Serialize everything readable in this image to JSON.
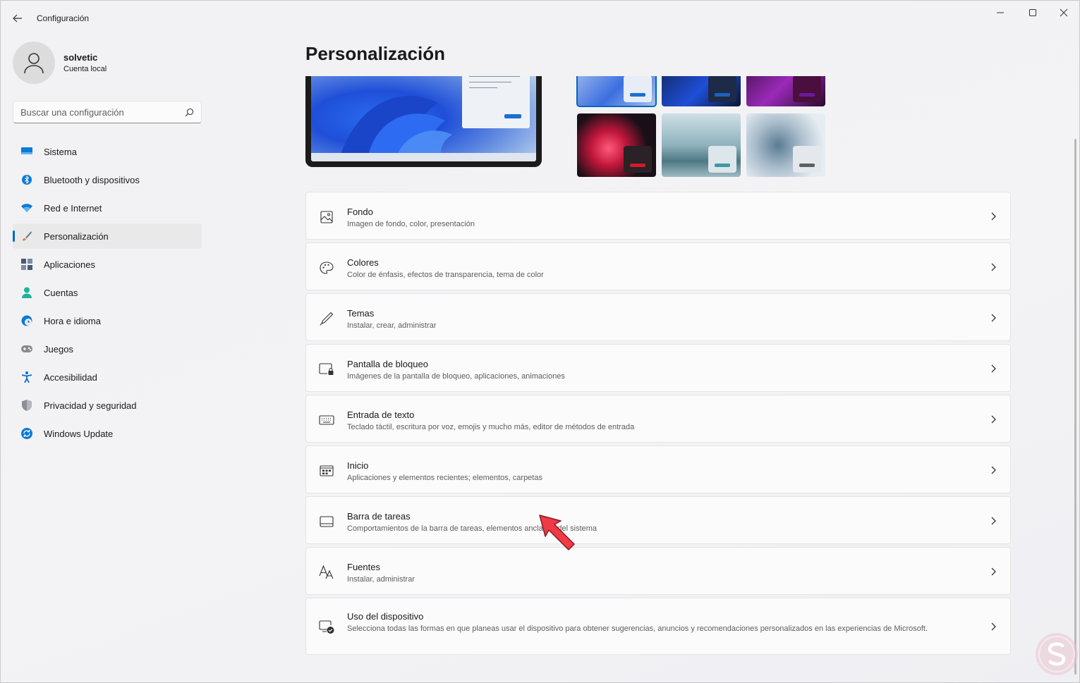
{
  "window": {
    "title": "Configuración",
    "controls": [
      "minimize",
      "maximize",
      "close"
    ]
  },
  "profile": {
    "name": "solvetic",
    "account_type": "Cuenta local"
  },
  "search": {
    "placeholder": "Buscar una configuración"
  },
  "nav": {
    "items": [
      {
        "label": "Sistema",
        "icon": "monitor-icon",
        "color": "#0a7bd6"
      },
      {
        "label": "Bluetooth y dispositivos",
        "icon": "bluetooth-icon",
        "color": "#0a7bd6"
      },
      {
        "label": "Red e Internet",
        "icon": "wifi-icon",
        "color": "#0a7bd6"
      },
      {
        "label": "Personalización",
        "icon": "brush-icon",
        "color": "#e8743b",
        "active": true
      },
      {
        "label": "Aplicaciones",
        "icon": "apps-icon",
        "color": "#4a5a74"
      },
      {
        "label": "Cuentas",
        "icon": "person-icon",
        "color": "#1db39a"
      },
      {
        "label": "Hora e idioma",
        "icon": "clock-globe-icon",
        "color": "#0a7bd6"
      },
      {
        "label": "Juegos",
        "icon": "gamepad-icon",
        "color": "#7a7a7a"
      },
      {
        "label": "Accesibilidad",
        "icon": "accessibility-icon",
        "color": "#0a6cc9"
      },
      {
        "label": "Privacidad y seguridad",
        "icon": "shield-icon",
        "color": "#7a7a7a"
      },
      {
        "label": "Windows Update",
        "icon": "update-icon",
        "color": "#0a7bd6"
      }
    ]
  },
  "main": {
    "title": "Personalización",
    "accent_color": "#0067c0",
    "themes": [
      {
        "name": "theme-light-bloom",
        "chip": "#1a6fd0",
        "chip_bg": "#e6edf6",
        "selected": true
      },
      {
        "name": "theme-dark-bloom",
        "chip": "#1f5fbf",
        "chip_bg": "#1d2a48"
      },
      {
        "name": "theme-glow",
        "chip": "#6a1a9a",
        "chip_bg": "#4a0f3f"
      },
      {
        "name": "theme-captured-motion",
        "chip": "#d11a2a",
        "chip_bg": "#2a2226"
      },
      {
        "name": "theme-sunrise",
        "chip": "#3a9aa8",
        "chip_bg": "#dde6ea"
      },
      {
        "name": "theme-flow",
        "chip": "#5a5f66",
        "chip_bg": "#e4e7eb"
      }
    ],
    "settings": [
      {
        "title": "Fondo",
        "subtitle": "Imagen de fondo, color, presentación",
        "icon": "image-icon"
      },
      {
        "title": "Colores",
        "subtitle": "Color de énfasis, efectos de transparencia, tema de color",
        "icon": "palette-icon"
      },
      {
        "title": "Temas",
        "subtitle": "Instalar, crear, administrar",
        "icon": "pen-icon"
      },
      {
        "title": "Pantalla de bloqueo",
        "subtitle": "Imágenes de la pantalla de bloqueo, aplicaciones, animaciones",
        "icon": "lock-screen-icon"
      },
      {
        "title": "Entrada de texto",
        "subtitle": "Teclado táctil, escritura por voz, emojis y mucho más, editor de métodos de entrada",
        "icon": "keyboard-icon"
      },
      {
        "title": "Inicio",
        "subtitle": "Aplicaciones y elementos recientes; elementos, carpetas",
        "icon": "start-icon"
      },
      {
        "title": "Barra de tareas",
        "subtitle": "Comportamientos de la barra de tareas, elementos anclados del sistema",
        "icon": "taskbar-icon"
      },
      {
        "title": "Fuentes",
        "subtitle": "Instalar, administrar",
        "icon": "fonts-icon"
      },
      {
        "title": "Uso del dispositivo",
        "subtitle": "Selecciona todas las formas en que planeas usar el dispositivo para obtener sugerencias, anuncios y recomendaciones personalizados en las experiencias de Microsoft.",
        "icon": "device-usage-icon"
      }
    ]
  },
  "annotation": {
    "arrow_color": "#f03a45"
  }
}
